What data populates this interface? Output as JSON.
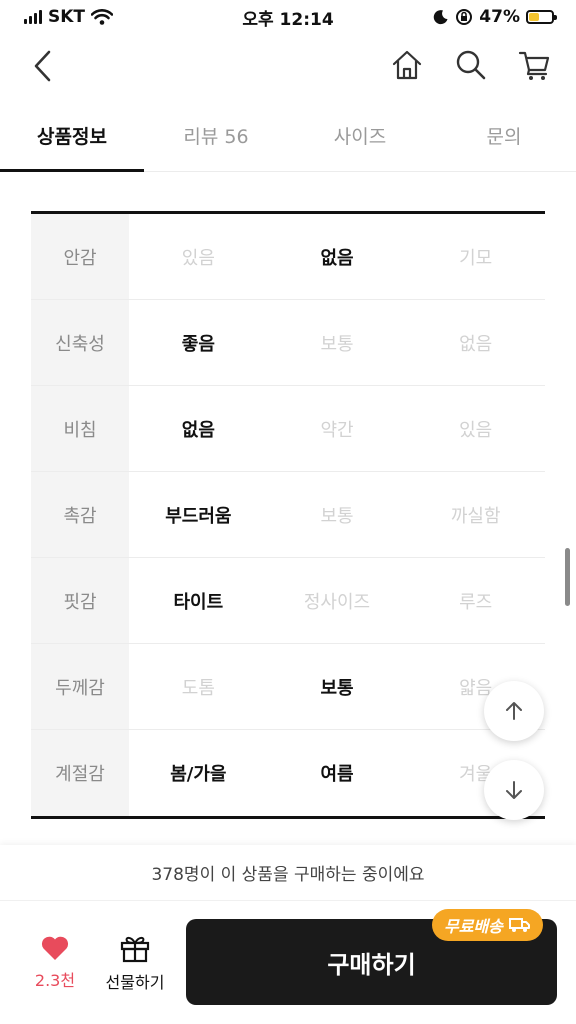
{
  "status_bar": {
    "carrier": "SKT",
    "time": "오후 12:14",
    "battery": "47%",
    "battery_level": 0.47
  },
  "nav": {
    "back_icon": "chevron-left-icon",
    "icons": [
      "home-icon",
      "search-icon",
      "cart-icon"
    ]
  },
  "tabs": [
    {
      "label": "상품정보",
      "active": true
    },
    {
      "label": "리뷰 56",
      "active": false
    },
    {
      "label": "사이즈",
      "active": false
    },
    {
      "label": "문의",
      "active": false
    }
  ],
  "attributes": [
    {
      "label": "안감",
      "options": [
        "있음",
        "없음",
        "기모"
      ],
      "selected": 1
    },
    {
      "label": "신축성",
      "options": [
        "좋음",
        "보통",
        "없음"
      ],
      "selected": 0
    },
    {
      "label": "비침",
      "options": [
        "없음",
        "약간",
        "있음"
      ],
      "selected": 0
    },
    {
      "label": "촉감",
      "options": [
        "부드러움",
        "보통",
        "까실함"
      ],
      "selected": 0
    },
    {
      "label": "핏감",
      "options": [
        "타이트",
        "정사이즈",
        "루즈"
      ],
      "selected": 0
    },
    {
      "label": "두께감",
      "options": [
        "도톰",
        "보통",
        "얇음"
      ],
      "selected": 1
    },
    {
      "label": "계절감",
      "options": [
        "봄/가을",
        "여름",
        "겨울"
      ],
      "selected": [
        0,
        1
      ]
    }
  ],
  "scroll_buttons": {
    "up_icon": "arrow-up-icon",
    "down_icon": "arrow-down-icon"
  },
  "bottom": {
    "purchase_notice": "378명이 이 상품을 구매하는 중이에요",
    "like_count": "2.3천",
    "gift_label": "선물하기",
    "buy_label": "구매하기",
    "free_shipping_badge": "무료배송",
    "colors": {
      "like": "#e84b5c",
      "buy_button": "#1a1a1a",
      "badge": "#f5a623",
      "battery_fill": "#f4c430"
    }
  }
}
